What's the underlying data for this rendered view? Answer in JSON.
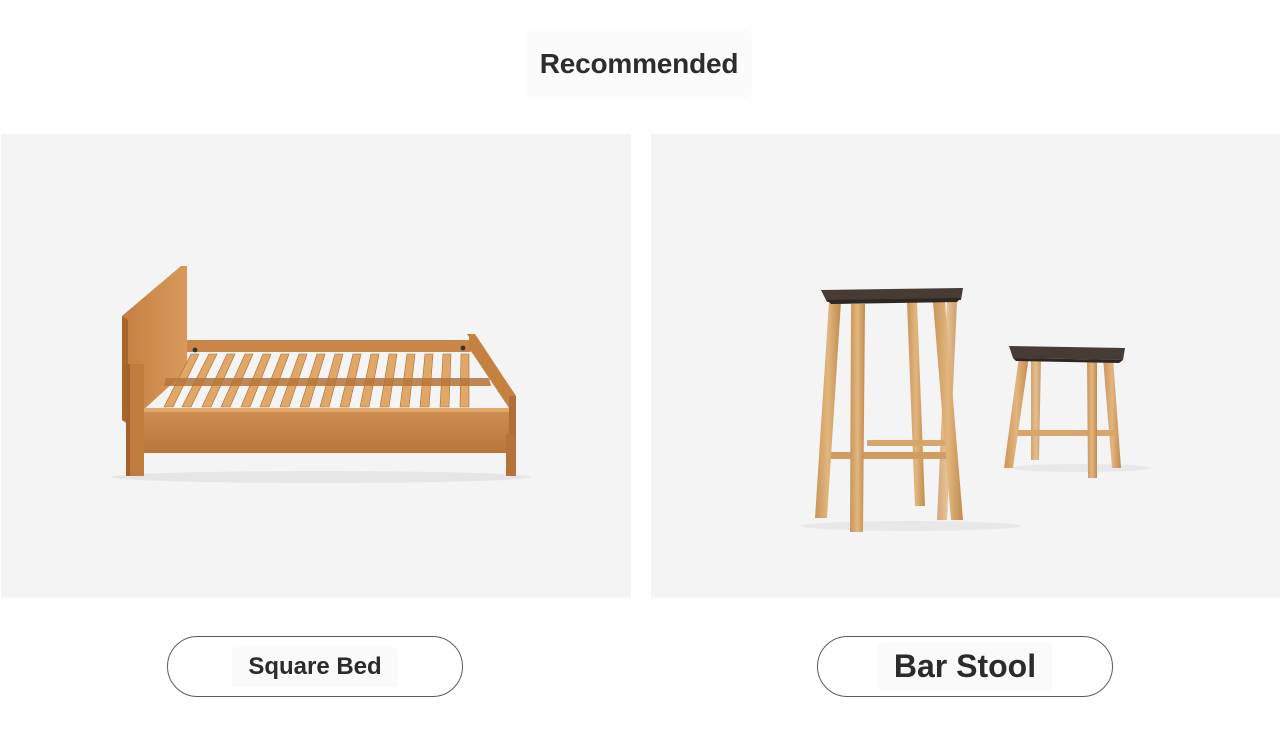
{
  "section": {
    "title": "Recommended"
  },
  "products": [
    {
      "name": "Square Bed",
      "image_icon": "wooden-slat-bed-illustration"
    },
    {
      "name": "Bar Stool",
      "image_icon": "wooden-bar-stools-illustration"
    }
  ],
  "colors": {
    "background": "#ffffff",
    "card_background": "#f4f4f4",
    "text": "#2e2e2e",
    "button_border": "#5c5c5c",
    "wood_light": "#c98a4b",
    "wood_oak": "#d6a56b",
    "seat_dark": "#4a3f38"
  }
}
